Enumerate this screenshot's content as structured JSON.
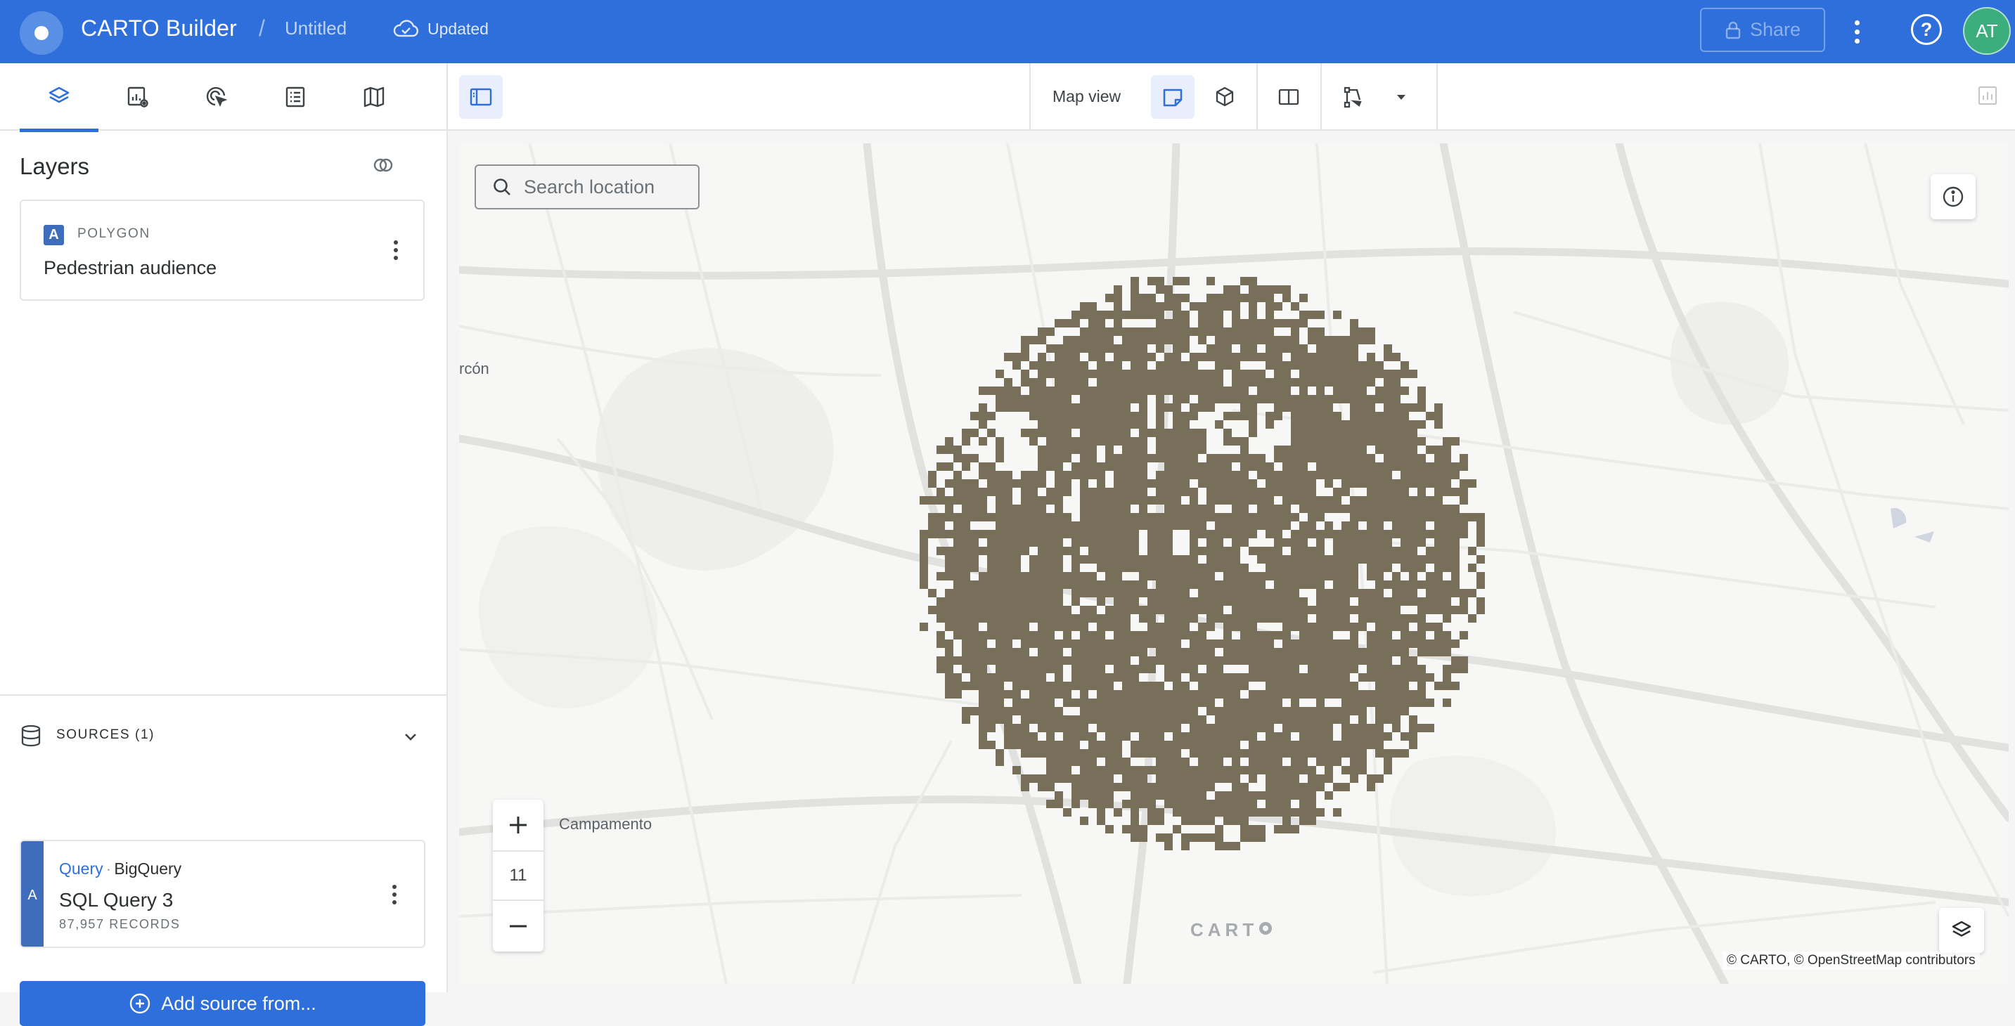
{
  "app": {
    "title": "CARTO Builder",
    "separator": "/",
    "map_name": "Untitled",
    "save_status": "Updated",
    "share_label": "Share",
    "user_initials": "AT",
    "help_label": "?"
  },
  "sidebar": {
    "tabs": [
      {
        "icon": "layers-icon",
        "active": true
      },
      {
        "icon": "widgets-icon",
        "active": false
      },
      {
        "icon": "interactions-icon",
        "active": false
      },
      {
        "icon": "legend-icon",
        "active": false
      },
      {
        "icon": "basemap-icon",
        "active": false
      }
    ],
    "layers_title": "Layers",
    "layers": [
      {
        "badge": "A",
        "type": "POLYGON",
        "name": "Pedestrian audience"
      }
    ],
    "sources_label": "SOURCES (1)",
    "sources": [
      {
        "badge": "A",
        "kind": "Query",
        "dot": "·",
        "provider": "BigQuery",
        "name": "SQL Query 3",
        "records": "87,957 RECORDS"
      }
    ],
    "add_source_label": "Add source from..."
  },
  "toolbar": {
    "map_view_label": "Map view"
  },
  "map": {
    "search_placeholder": "Search location",
    "zoom_level": "11",
    "zoom_in": "+",
    "zoom_out": "−",
    "attribution": "© CARTO, © OpenStreetMap contributors",
    "watermark": "CART",
    "place_labels": [
      "rcón",
      "Campamento"
    ],
    "layer_color": "#786f5b",
    "basemap_color": "#f7f7f6",
    "accent_color": "#2e6fdb"
  }
}
